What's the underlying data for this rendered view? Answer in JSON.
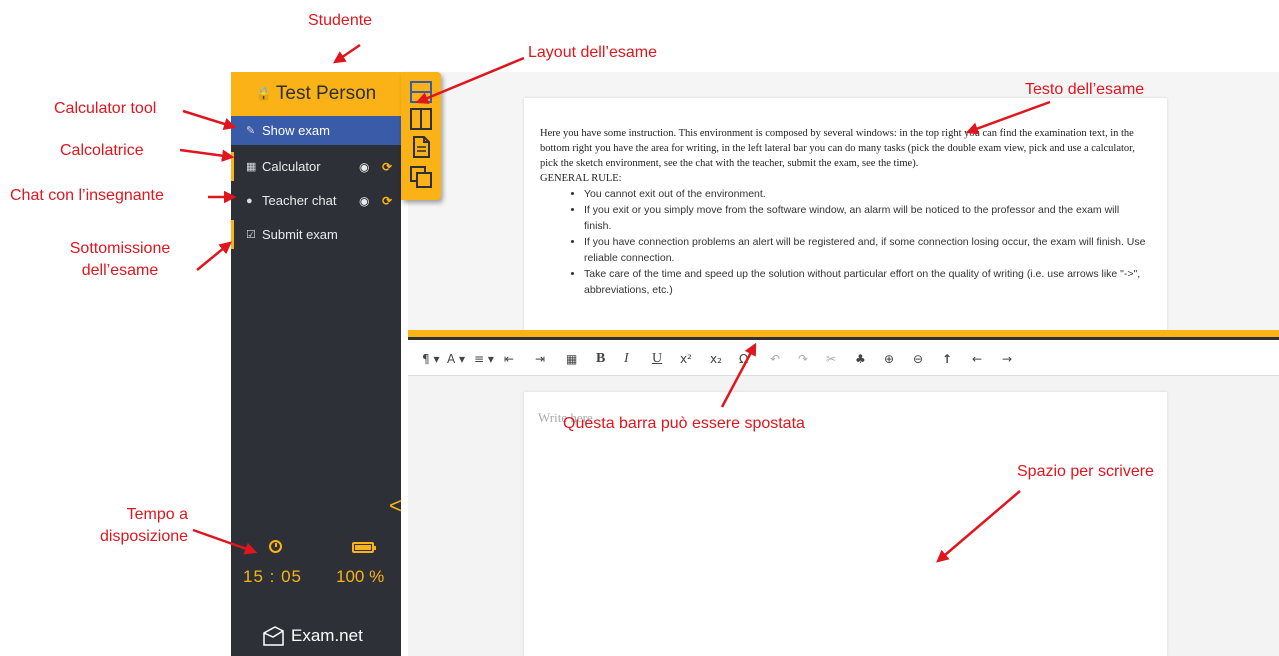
{
  "sidebar": {
    "student_name": "Test Person",
    "items": [
      {
        "label": "Show exam",
        "icon": "edit-icon",
        "active": true
      },
      {
        "label": "Calculator",
        "icon": "calculator-icon",
        "active": false
      },
      {
        "label": "Teacher chat",
        "icon": "chat-icon",
        "active": false
      },
      {
        "label": "Submit exam",
        "icon": "check-square-icon",
        "active": false
      }
    ],
    "time_left": "15 : 05",
    "battery_level": "100 %",
    "brand": "Exam.net"
  },
  "exam": {
    "intro": "Here you have some instruction. This environment is composed by several windows: in the top right you can find the examination text, in the bottom right you have the area for writing, in the left lateral bar you can do many tasks (pick the double exam view, pick and use a calculator, pick the sketch environment, see the chat with the teacher, submit the exam, see the time).",
    "rule_heading": "GENERAL RULE:",
    "rules": [
      "You cannot exit out of the environment.",
      "If you exit or you simply move from the software window, an alarm will be noticed to the professor and the exam will finish.",
      "If you have connection problems an alert will be registered and, if some connection losing occur, the exam will finish. Use reliable connection.",
      "Take care of the time and speed up the solution without particular effort on the quality of writing (i.e. use arrows like \"->\", abbreviations, etc.)"
    ]
  },
  "toolbar": {
    "paragraph": "¶ ▾",
    "font": "A ▾",
    "align": "≡ ▾",
    "outdent": "⇤",
    "indent": "⇥",
    "table": "▦",
    "bold": "B",
    "italic": "I",
    "underline": "U",
    "superscript": "x²",
    "subscript": "x₂",
    "omega": "Ω",
    "undo": "↶",
    "redo": "↷",
    "cut": "✂",
    "puzzle": "♣",
    "zoom_in": "⊕",
    "zoom_out": "⊖",
    "arrow_up": "↑",
    "arrow_left": "←",
    "arrow_right": "→"
  },
  "editor": {
    "placeholder": "Write here"
  },
  "annotations": {
    "studente": "Studente",
    "layout": "Layout dell’esame",
    "testo": "Testo dell’esame",
    "calculator_tool": "Calculator tool",
    "calcolatrice": "Calcolatrice",
    "chat": "Chat con l’insegnante",
    "sottomissione_1": "Sottomissione",
    "sottomissione_2": "dell’esame",
    "tempo_1": "Tempo a",
    "tempo_2": "disposizione",
    "barra": "Questa barra può essere spostata",
    "spazio": "Spazio per scrivere"
  },
  "colors": {
    "accent": "#fbb217",
    "sidebar": "#2d3037",
    "active": "#3a5ba8",
    "annotation": "#e0161e"
  }
}
